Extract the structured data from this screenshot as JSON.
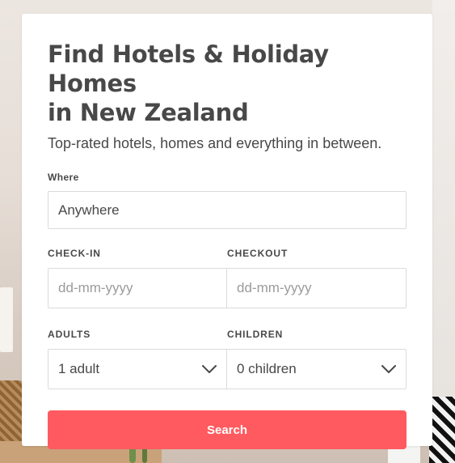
{
  "hero": {
    "title_line1": "Find Hotels & Holiday Homes",
    "title_line2": "in New Zealand",
    "subtitle": "Top-rated hotels, homes and everything in between."
  },
  "form": {
    "where": {
      "label": "Where",
      "value": "Anywhere"
    },
    "checkin": {
      "label": "CHECK-IN",
      "placeholder": "dd-mm-yyyy"
    },
    "checkout": {
      "label": "CHECKOUT",
      "placeholder": "dd-mm-yyyy"
    },
    "adults": {
      "label": "ADULTS",
      "value": "1 adult",
      "icon": "chevron-down-icon"
    },
    "children": {
      "label": "CHILDREN",
      "value": "0 children",
      "icon": "chevron-down-icon"
    },
    "search_label": "Search"
  },
  "colors": {
    "accent": "#ff5a5f",
    "text": "#484848",
    "placeholder": "#9b9b9b",
    "border": "#dbdbdb"
  }
}
